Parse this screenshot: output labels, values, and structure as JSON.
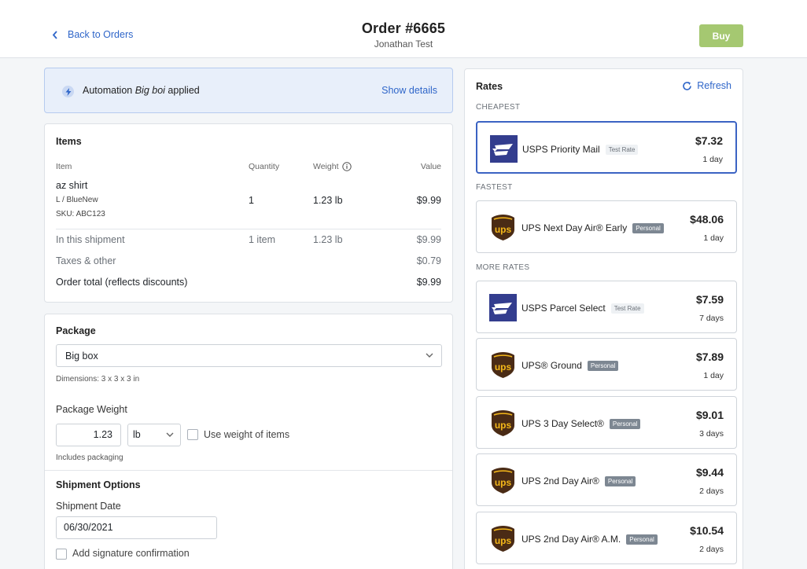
{
  "header": {
    "back_label": "Back to Orders",
    "title": "Order #6665",
    "subtitle": "Jonathan Test",
    "buy_label": "Buy"
  },
  "banner": {
    "prefix": "Automation ",
    "name": "Big boi",
    "suffix": " applied",
    "show_details": "Show details"
  },
  "items": {
    "title": "Items",
    "columns": {
      "item": "Item",
      "quantity": "Quantity",
      "weight": "Weight",
      "value": "Value"
    },
    "rows": [
      {
        "name": "az shirt",
        "variant": "L / BlueNew",
        "sku": "SKU: ABC123",
        "quantity": "1",
        "weight": "1.23 lb",
        "value": "$9.99"
      }
    ],
    "shipment": {
      "label": "In this shipment",
      "quantity": "1 item",
      "weight": "1.23 lb",
      "value": "$9.99"
    },
    "taxes": {
      "label": "Taxes & other",
      "value": "$0.79"
    },
    "total": {
      "label": "Order total (reflects discounts)",
      "value": "$9.99"
    }
  },
  "package": {
    "title": "Package",
    "selected": "Big box",
    "dimensions": "Dimensions: 3 x 3 x 3 in",
    "weight_label": "Package Weight",
    "weight_value": "1.23",
    "unit": "lb",
    "use_weight_label": "Use weight of items",
    "includes_packaging": "Includes packaging"
  },
  "shipment_options": {
    "title": "Shipment Options",
    "date_label": "Shipment Date",
    "date_value": "06/30/2021",
    "signature_label": "Add signature confirmation"
  },
  "rates": {
    "title": "Rates",
    "refresh_label": "Refresh",
    "cheapest_label": "CHEAPEST",
    "fastest_label": "FASTEST",
    "more_label": "MORE RATES",
    "cheapest": {
      "carrier": "usps",
      "name": "USPS Priority Mail",
      "badge": "Test Rate",
      "price": "$7.32",
      "days": "1 day"
    },
    "fastest": {
      "carrier": "ups",
      "name": "UPS Next Day Air® Early",
      "badge": "Personal",
      "price": "$48.06",
      "days": "1 day"
    },
    "more": [
      {
        "carrier": "usps",
        "name": "USPS Parcel Select",
        "badge": "Test Rate",
        "price": "$7.59",
        "days": "7 days"
      },
      {
        "carrier": "ups",
        "name": "UPS® Ground",
        "badge": "Personal",
        "price": "$7.89",
        "days": "1 day"
      },
      {
        "carrier": "ups",
        "name": "UPS 3 Day Select®",
        "badge": "Personal",
        "price": "$9.01",
        "days": "3 days"
      },
      {
        "carrier": "ups",
        "name": "UPS 2nd Day Air®",
        "badge": "Personal",
        "price": "$9.44",
        "days": "2 days"
      },
      {
        "carrier": "ups",
        "name": "UPS 2nd Day Air® A.M.",
        "badge": "Personal",
        "price": "$10.54",
        "days": "2 days"
      }
    ]
  },
  "colors": {
    "accent": "#2f66c9",
    "buy_button": "#a5c871",
    "selected_border": "#3b63c3",
    "usps_blue": "#333d8e",
    "ups_brown": "#4a2b15",
    "ups_gold": "#f5b819"
  }
}
